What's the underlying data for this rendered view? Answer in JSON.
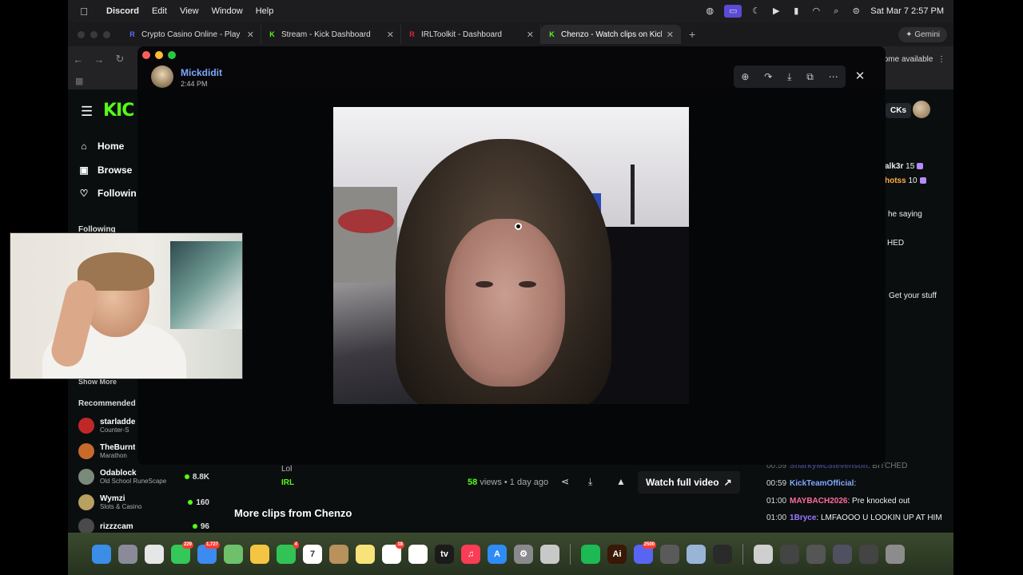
{
  "menubar": {
    "app": "Discord",
    "items": [
      "Edit",
      "View",
      "Window",
      "Help"
    ],
    "clock": "Sat Mar 7  2:57 PM"
  },
  "browser": {
    "tabs": [
      {
        "title": "Crypto Casino Online - Play w",
        "fav_color": "#5b6cff",
        "fav_letter": "R"
      },
      {
        "title": "Stream - Kick Dashboard",
        "fav_color": "#53fc18",
        "fav_letter": "K"
      },
      {
        "title": "IRLToolkit - Dashboard",
        "fav_color": "#e0243c",
        "fav_letter": "R"
      },
      {
        "title": "Chenzo - Watch clips on Kick",
        "fav_color": "#53fc18",
        "fav_letter": "K",
        "active": true
      }
    ],
    "gemini_label": "Gemini",
    "update_label": "ome available"
  },
  "kick": {
    "logo": "KIC",
    "nav": [
      {
        "label": "Home",
        "icon": "home-icon",
        "glyph": "⌂"
      },
      {
        "label": "Browse",
        "icon": "browse-icon",
        "glyph": "▣"
      },
      {
        "label": "Followin",
        "icon": "heart-icon",
        "glyph": "♡"
      }
    ],
    "following_label": "Following",
    "show_more": "Show More",
    "recommended_label": "Recommended",
    "recommended": [
      {
        "name": "starladde",
        "category": "Counter-S",
        "viewers": "",
        "color": "#c02828"
      },
      {
        "name": "TheBurnt",
        "category": "Marathon",
        "viewers": "",
        "color": "#c86a2a"
      },
      {
        "name": "Odablock",
        "category": "Old School RuneScape",
        "viewers": "8.8K",
        "color": "#7a8a7a"
      },
      {
        "name": "Wymzi",
        "category": "Slots & Casino",
        "viewers": "160",
        "color": "#b8a060"
      },
      {
        "name": "rizzzcam",
        "category": "",
        "viewers": "96",
        "color": "#4a4a4a"
      }
    ],
    "clip_meta": "Lol",
    "clip_category": "IRL",
    "views_count": "58",
    "views_suffix": "views • 1 day ago",
    "watch_full": "Watch full video",
    "more_clips": "More clips from Chenzo",
    "top_right_label": "CKs",
    "right_chat": [
      {
        "user": "alk3r",
        "text": "15"
      },
      {
        "user": "hotss",
        "text": "10"
      },
      {
        "user": "",
        "text": "he saying"
      },
      {
        "user": "",
        "text": "HED"
      },
      {
        "user": "",
        "text": "Get your stuff"
      }
    ],
    "chat": [
      {
        "time": "00:59",
        "user": "SharkyMcStevenson",
        "user_color": "#7a7aff",
        "text": "BITCHED"
      },
      {
        "time": "00:59",
        "user": "KickTeamOfficial",
        "user_color": "#7fa8ff",
        "text": ""
      },
      {
        "time": "01:00",
        "user": "MAYBACH2026",
        "user_color": "#ff6b9a",
        "text": "Pre knocked out"
      },
      {
        "time": "01:00",
        "user": "1Bryce",
        "user_color": "#9b7bff",
        "text": "LMFAOOO U LOOKIN UP AT HIM"
      }
    ]
  },
  "discord_viewer": {
    "author": "Mickdidit",
    "time": "2:44 PM",
    "tools": [
      "zoom-in-icon",
      "forward-icon",
      "download-icon",
      "open-external-icon",
      "more-icon"
    ],
    "tool_glyphs": [
      "⊕",
      "↷",
      "⤓",
      "⧉",
      "⋯"
    ],
    "close_glyph": "✕"
  },
  "dock": {
    "apps": [
      {
        "name": "finder-icon",
        "color": "#3a8ee6",
        "label": "",
        "badge": ""
      },
      {
        "name": "launchpad-icon",
        "color": "#8a8a9a",
        "label": "",
        "badge": ""
      },
      {
        "name": "chrome-icon",
        "color": "#e6e6e6",
        "label": "",
        "badge": ""
      },
      {
        "name": "messages-icon",
        "color": "#34c759",
        "label": "",
        "badge": "229"
      },
      {
        "name": "mail-icon",
        "color": "#3b8bf0",
        "label": "",
        "badge": "1,727"
      },
      {
        "name": "maps-icon",
        "color": "#6ec06a",
        "label": "",
        "badge": ""
      },
      {
        "name": "photos-icon",
        "color": "#f4c542",
        "label": "",
        "badge": ""
      },
      {
        "name": "facetime-icon",
        "color": "#31c455",
        "label": "",
        "badge": "4"
      },
      {
        "name": "calendar-icon",
        "color": "#ffffff",
        "label": "7",
        "badge": ""
      },
      {
        "name": "contacts-icon",
        "color": "#b9915c",
        "label": "",
        "badge": ""
      },
      {
        "name": "notes-icon",
        "color": "#f8e27a",
        "label": "",
        "badge": ""
      },
      {
        "name": "reminders-icon",
        "color": "#ffffff",
        "label": "",
        "badge": "18"
      },
      {
        "name": "freeform-icon",
        "color": "#ffffff",
        "label": "",
        "badge": ""
      },
      {
        "name": "tv-icon",
        "color": "#1b1b1b",
        "label": "tv",
        "badge": ""
      },
      {
        "name": "music-icon",
        "color": "#fa3c55",
        "label": "♫",
        "badge": ""
      },
      {
        "name": "appstore-icon",
        "color": "#2f8cf7",
        "label": "A",
        "badge": ""
      },
      {
        "name": "settings-icon",
        "color": "#8a8a8e",
        "label": "⚙",
        "badge": ""
      },
      {
        "name": "screenshot-icon",
        "color": "#c8c8c8",
        "label": "",
        "badge": ""
      },
      {
        "name": "spotify-icon",
        "color": "#1db954",
        "label": "",
        "badge": ""
      },
      {
        "name": "illustrator-icon",
        "color": "#3a1806",
        "label": "Ai",
        "badge": ""
      },
      {
        "name": "discord-icon",
        "color": "#5865f2",
        "label": "",
        "badge": "2500"
      },
      {
        "name": "calculator-icon",
        "color": "#5a5a5a",
        "label": "",
        "badge": ""
      },
      {
        "name": "preview-icon",
        "color": "#9ab4d8",
        "label": "",
        "badge": ""
      },
      {
        "name": "obs-icon",
        "color": "#2a2a2a",
        "label": "",
        "badge": ""
      },
      {
        "name": "podcast-icon",
        "color": "#cfcfcf",
        "label": "",
        "badge": ""
      },
      {
        "name": "window-icon",
        "color": "#444",
        "label": "",
        "badge": ""
      },
      {
        "name": "window-icon",
        "color": "#555",
        "label": "",
        "badge": ""
      },
      {
        "name": "window-icon",
        "color": "#505060",
        "label": "",
        "badge": ""
      },
      {
        "name": "window-icon",
        "color": "#444",
        "label": "",
        "badge": ""
      },
      {
        "name": "trash-icon",
        "color": "#8c8c8c",
        "label": "",
        "badge": ""
      }
    ]
  }
}
